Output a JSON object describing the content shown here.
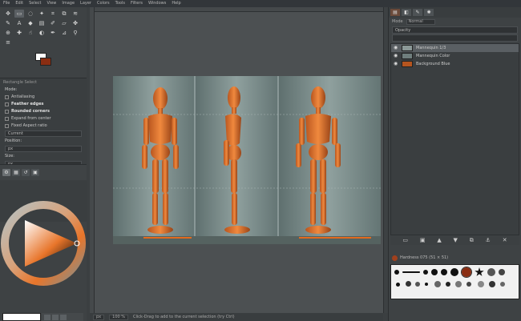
{
  "menu": [
    "File",
    "Edit",
    "Select",
    "View",
    "Image",
    "Layer",
    "Colors",
    "Tools",
    "Filters",
    "Windows",
    "Help"
  ],
  "colors": {
    "fg": "#ffffff",
    "bg": "#8a2d12",
    "accent": "#e8752a"
  },
  "tool_options": {
    "title": "Rectangle Select",
    "mode_label": "Mode:",
    "antialias_label": "Antialiasing",
    "feather_label": "Feather edges",
    "rounded_label": "Rounded corners",
    "expand_label": "Expand from center",
    "fixed_label": "Fixed",
    "fixed_value": "Aspect ratio",
    "current_value": "Current",
    "position_label": "Position:",
    "position_value": "px",
    "size_label": "Size:",
    "size_value": "px"
  },
  "canvas": {
    "zoom_value": "100 %",
    "unit_value": "px",
    "status_text": "Click-Drag to add to the current selection (try Ctrl)"
  },
  "layers_panel": {
    "mode_label": "Mode",
    "mode_value": "Normal",
    "opacity_value": "Opacity",
    "items": [
      {
        "name": "Mannequin 1/3"
      },
      {
        "name": "Mannequin Color"
      },
      {
        "name": "Background Blue"
      }
    ]
  },
  "brushes_panel": {
    "title": "Hardness 075 (51 × 51)"
  }
}
